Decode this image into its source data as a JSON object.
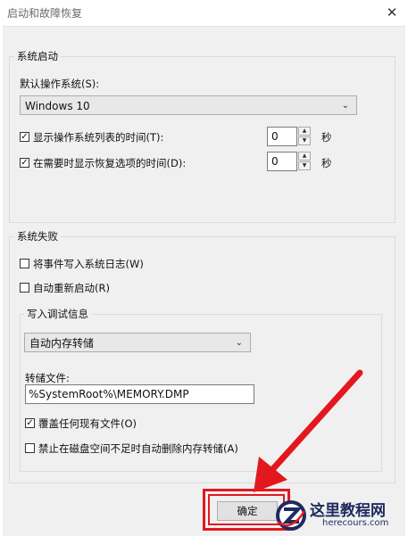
{
  "window": {
    "title": "启动和故障恢复",
    "close_glyph": "✕"
  },
  "startup": {
    "group_title": "系统启动",
    "default_os_label": "默认操作系统(S):",
    "default_os_value": "Windows 10",
    "show_os_list": {
      "label": "显示操作系统列表的时间(T):",
      "checked": true,
      "value": "0",
      "unit": "秒"
    },
    "show_recovery": {
      "label": "在需要时显示恢复选项的时间(D):",
      "checked": true,
      "value": "0",
      "unit": "秒"
    }
  },
  "failure": {
    "group_title": "系统失败",
    "write_event": {
      "label": "将事件写入系统日志(W)",
      "checked": false
    },
    "auto_restart": {
      "label": "自动重新启动(R)",
      "checked": false
    },
    "debug": {
      "group_title": "写入调试信息",
      "dump_type": "自动内存转储",
      "dump_file_label": "转储文件:",
      "dump_file_value": "%SystemRoot%\\MEMORY.DMP",
      "overwrite": {
        "label": "覆盖任何现有文件(O)",
        "checked": true
      },
      "disable_auto_delete": {
        "label": "禁止在磁盘空间不足时自动删除内存转储(A)",
        "checked": false
      }
    }
  },
  "buttons": {
    "ok": "确定"
  },
  "watermark": {
    "cn": "这里教程网",
    "en": "herecours.com"
  },
  "colors": {
    "annotation_red": "#e3181f",
    "dialog_bg": "#f0f0f0",
    "watermark_navy": "#1e2a5e"
  },
  "checkmark_glyph": "✓",
  "spin_up_glyph": "▲",
  "spin_down_glyph": "▼",
  "combo_arrow_glyph": "⌄"
}
